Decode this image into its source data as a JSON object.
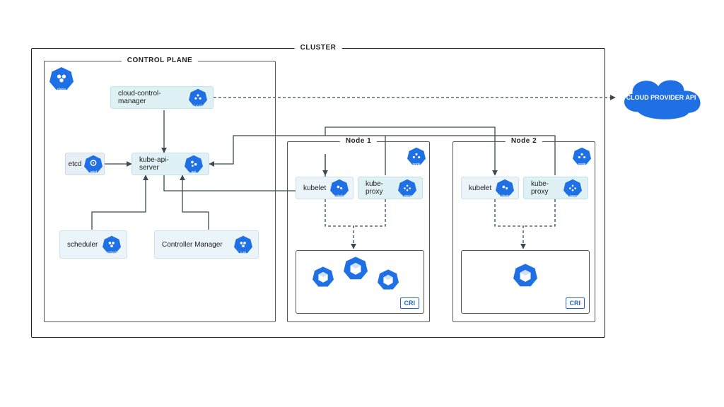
{
  "colors": {
    "accent": "#1F6FE5",
    "accent_dark": "#1757B8",
    "soft": "#EAF4F9",
    "stroke": "#222222"
  },
  "cluster": {
    "title": "CLUSTER"
  },
  "control_plane": {
    "title": "CONTROL PLANE",
    "plane_badge": "plane",
    "ccm": {
      "label": "cloud-control-manager",
      "badge": "c-c-m"
    },
    "etcd": {
      "label": "etcd",
      "badge": "etcd"
    },
    "api": {
      "label": "kube-api-server",
      "badge": "api"
    },
    "scheduler": {
      "label": "scheduler",
      "badge": "sched"
    },
    "cm": {
      "label": "Controller Manager",
      "badge": "c-m"
    }
  },
  "nodes": [
    {
      "title": "Node 1",
      "node_badge": "node",
      "kubelet": {
        "label": "kubelet",
        "badge": "kubelet"
      },
      "kproxy": {
        "label": "kube-proxy",
        "badge": "k-proxy"
      },
      "cri": "CRI",
      "pods": [
        {
          "label": "pod"
        },
        {
          "label": "pod"
        },
        {
          "label": "pod"
        }
      ]
    },
    {
      "title": "Node 2",
      "node_badge": "node",
      "kubelet": {
        "label": "kubelet",
        "badge": "kubelet"
      },
      "kproxy": {
        "label": "kube-proxy",
        "badge": "k-proxy"
      },
      "cri": "CRI",
      "pods": [
        {
          "label": "pod"
        }
      ]
    }
  ],
  "cloud": {
    "label": "CLOUD PROVIDER API"
  }
}
